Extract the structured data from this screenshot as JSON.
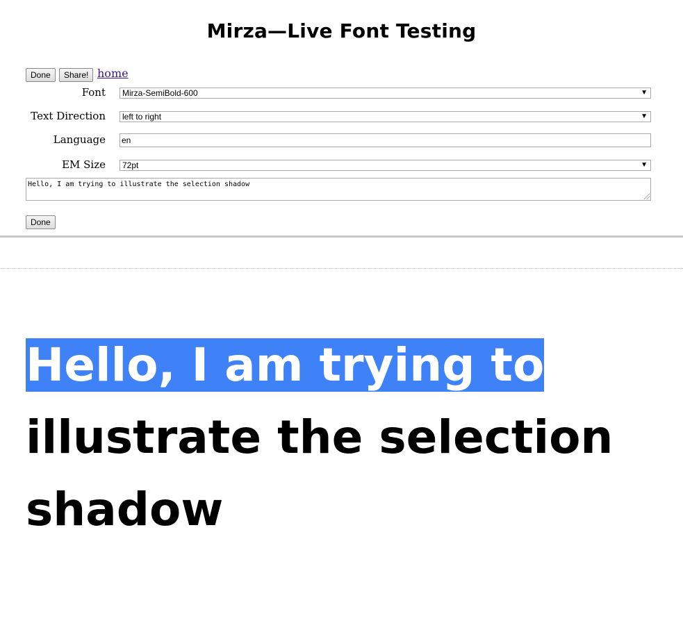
{
  "title": "Mirza—Live Font Testing",
  "toolbar": {
    "done_label": "Done",
    "share_label": "Share!",
    "home_label": "home"
  },
  "form": {
    "font_label": "Font",
    "font_value": "Mirza-SemiBold-600",
    "direction_label": "Text Direction",
    "direction_value": "left to right",
    "language_label": "Language",
    "language_value": "en",
    "em_size_label": "EM Size",
    "em_size_value": "72pt",
    "sample_text": "Hello, I am trying to illustrate the selection shadow",
    "done_bottom_label": "Done"
  },
  "preview": {
    "selected_text": "Hello, I am trying to",
    "rest_line1": "illustrate the selection",
    "rest_line2": "shadow"
  },
  "colors": {
    "selection_bg": "#3f82f8",
    "link": "#3b1a8a"
  },
  "icons": {
    "dropdown": "chevron-down-icon",
    "resize": "resize-grip-icon"
  }
}
